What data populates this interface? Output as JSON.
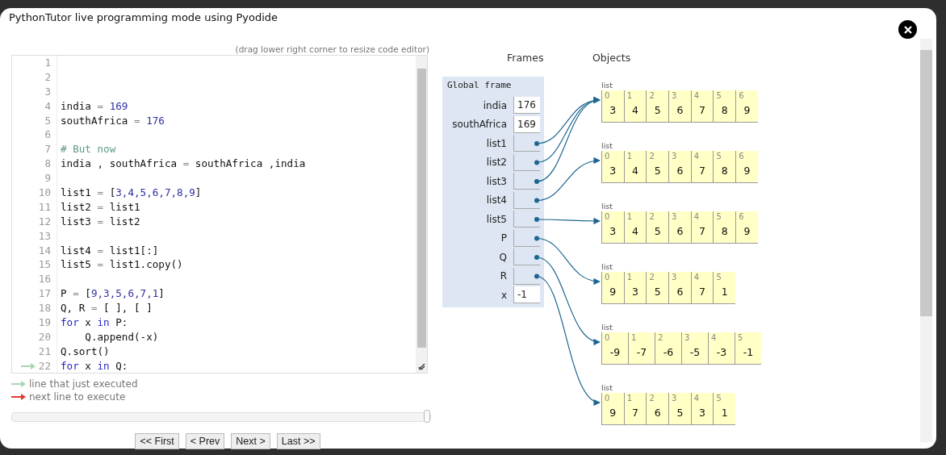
{
  "dialog": {
    "title": "PythonTutor live programming mode using Pyodide"
  },
  "editor": {
    "hint": "(drag lower right corner to resize code editor)",
    "lines": [
      {
        "number": "1",
        "executed": false
      },
      {
        "number": "2",
        "executed": false
      },
      {
        "number": "3",
        "executed": false
      },
      {
        "number": "4",
        "executed": false,
        "tokens": [
          {
            "text": "india ",
            "kind": "plain"
          },
          {
            "text": "= ",
            "kind": "op"
          },
          {
            "text": "169",
            "kind": "num"
          }
        ]
      },
      {
        "number": "5",
        "executed": false,
        "tokens": [
          {
            "text": "southAfrica ",
            "kind": "plain"
          },
          {
            "text": "= ",
            "kind": "op"
          },
          {
            "text": "176",
            "kind": "num"
          }
        ]
      },
      {
        "number": "6",
        "executed": false
      },
      {
        "number": "7",
        "executed": false,
        "tokens": [
          {
            "text": "# But now",
            "kind": "comment"
          }
        ]
      },
      {
        "number": "8",
        "executed": false,
        "tokens": [
          {
            "text": "india , southAfrica ",
            "kind": "plain"
          },
          {
            "text": "= ",
            "kind": "op"
          },
          {
            "text": "southAfrica ,india",
            "kind": "plain"
          }
        ]
      },
      {
        "number": "9",
        "executed": false
      },
      {
        "number": "10",
        "executed": false,
        "tokens": [
          {
            "text": "list1 ",
            "kind": "plain"
          },
          {
            "text": "= ",
            "kind": "op"
          },
          {
            "text": "[",
            "kind": "plain"
          },
          {
            "text": "3,4,5,6,7,8,9",
            "kind": "num"
          },
          {
            "text": "]",
            "kind": "plain"
          }
        ]
      },
      {
        "number": "11",
        "executed": false,
        "tokens": [
          {
            "text": "list2 ",
            "kind": "plain"
          },
          {
            "text": "= ",
            "kind": "op"
          },
          {
            "text": "list1",
            "kind": "plain"
          }
        ]
      },
      {
        "number": "12",
        "executed": false,
        "tokens": [
          {
            "text": "list3 ",
            "kind": "plain"
          },
          {
            "text": "= ",
            "kind": "op"
          },
          {
            "text": "list2",
            "kind": "plain"
          }
        ]
      },
      {
        "number": "13",
        "executed": false
      },
      {
        "number": "14",
        "executed": false,
        "tokens": [
          {
            "text": "list4 ",
            "kind": "plain"
          },
          {
            "text": "= ",
            "kind": "op"
          },
          {
            "text": "list1[:]",
            "kind": "plain"
          }
        ]
      },
      {
        "number": "15",
        "executed": false,
        "tokens": [
          {
            "text": "list5 ",
            "kind": "plain"
          },
          {
            "text": "= ",
            "kind": "op"
          },
          {
            "text": "list1.copy()",
            "kind": "plain"
          }
        ]
      },
      {
        "number": "16",
        "executed": false
      },
      {
        "number": "17",
        "executed": false,
        "tokens": [
          {
            "text": "P ",
            "kind": "plain"
          },
          {
            "text": "= ",
            "kind": "op"
          },
          {
            "text": "[",
            "kind": "plain"
          },
          {
            "text": "9,3,5,6,7,1",
            "kind": "num"
          },
          {
            "text": "]",
            "kind": "plain"
          }
        ]
      },
      {
        "number": "18",
        "executed": false,
        "tokens": [
          {
            "text": "Q, R ",
            "kind": "plain"
          },
          {
            "text": "= ",
            "kind": "op"
          },
          {
            "text": "[ ], [ ]",
            "kind": "plain"
          }
        ]
      },
      {
        "number": "19",
        "executed": false,
        "tokens": [
          {
            "text": "for",
            "kind": "kw"
          },
          {
            "text": " x ",
            "kind": "plain"
          },
          {
            "text": "in",
            "kind": "kw"
          },
          {
            "text": " P:",
            "kind": "plain"
          }
        ]
      },
      {
        "number": "20",
        "executed": false,
        "tokens": [
          {
            "text": "    Q.append(-x)",
            "kind": "plain"
          }
        ]
      },
      {
        "number": "21",
        "executed": false,
        "tokens": [
          {
            "text": "Q.sort()",
            "kind": "plain"
          }
        ]
      },
      {
        "number": "22",
        "executed": true,
        "tokens": [
          {
            "text": "for",
            "kind": "kw"
          },
          {
            "text": " x ",
            "kind": "plain"
          },
          {
            "text": "in",
            "kind": "kw"
          },
          {
            "text": " Q:",
            "kind": "plain"
          }
        ]
      }
    ]
  },
  "legend": [
    {
      "kind": "executed",
      "label": "line that just executed"
    },
    {
      "kind": "next",
      "label": "next line to execute"
    }
  ],
  "slider": {
    "level": 1
  },
  "buttons": [
    "<< First",
    "< Prev",
    "Next >",
    "Last >>"
  ],
  "visualizer": {
    "frames_heading": "Frames",
    "objects_heading": "Objects",
    "frame": {
      "title": "Global frame",
      "variables": [
        {
          "name": "india",
          "kind": "value",
          "value": "176"
        },
        {
          "name": "southAfrica",
          "kind": "value",
          "value": "169"
        },
        {
          "name": "list1",
          "kind": "pointer",
          "same_object_as_previous": false
        },
        {
          "name": "list2",
          "kind": "pointer",
          "same_object_as_previous": true
        },
        {
          "name": "list3",
          "kind": "pointer",
          "same_object_as_previous": true
        },
        {
          "name": "list4",
          "kind": "pointer",
          "same_object_as_previous": false
        },
        {
          "name": "list5",
          "kind": "pointer",
          "same_object_as_previous": false
        },
        {
          "name": "P",
          "kind": "pointer",
          "same_object_as_previous": false
        },
        {
          "name": "Q",
          "kind": "pointer",
          "same_object_as_previous": false
        },
        {
          "name": "R",
          "kind": "pointer",
          "same_object_as_previous": false
        },
        {
          "name": "x",
          "kind": "value",
          "value": "-1"
        }
      ]
    },
    "objects": [
      {
        "label": "list",
        "items": [
          {
            "index": "0",
            "value": "3"
          },
          {
            "index": "1",
            "value": "4"
          },
          {
            "index": "2",
            "value": "5"
          },
          {
            "index": "3",
            "value": "6"
          },
          {
            "index": "4",
            "value": "7"
          },
          {
            "index": "5",
            "value": "8"
          },
          {
            "index": "6",
            "value": "9"
          }
        ]
      },
      {
        "label": "list",
        "items": [
          {
            "index": "0",
            "value": "3"
          },
          {
            "index": "1",
            "value": "4"
          },
          {
            "index": "2",
            "value": "5"
          },
          {
            "index": "3",
            "value": "6"
          },
          {
            "index": "4",
            "value": "7"
          },
          {
            "index": "5",
            "value": "8"
          },
          {
            "index": "6",
            "value": "9"
          }
        ]
      },
      {
        "label": "list",
        "items": [
          {
            "index": "0",
            "value": "3"
          },
          {
            "index": "1",
            "value": "4"
          },
          {
            "index": "2",
            "value": "5"
          },
          {
            "index": "3",
            "value": "6"
          },
          {
            "index": "4",
            "value": "7"
          },
          {
            "index": "5",
            "value": "8"
          },
          {
            "index": "6",
            "value": "9"
          }
        ]
      },
      {
        "label": "list",
        "items": [
          {
            "index": "0",
            "value": "9"
          },
          {
            "index": "1",
            "value": "3"
          },
          {
            "index": "2",
            "value": "5"
          },
          {
            "index": "3",
            "value": "6"
          },
          {
            "index": "4",
            "value": "7"
          },
          {
            "index": "5",
            "value": "1"
          }
        ]
      },
      {
        "label": "list",
        "items": [
          {
            "index": "0",
            "value": "-9"
          },
          {
            "index": "1",
            "value": "-7"
          },
          {
            "index": "2",
            "value": "-6"
          },
          {
            "index": "3",
            "value": "-5"
          },
          {
            "index": "4",
            "value": "-3"
          },
          {
            "index": "5",
            "value": "-1"
          }
        ]
      },
      {
        "label": "list",
        "items": [
          {
            "index": "0",
            "value": "9"
          },
          {
            "index": "1",
            "value": "7"
          },
          {
            "index": "2",
            "value": "6"
          },
          {
            "index": "3",
            "value": "5"
          },
          {
            "index": "4",
            "value": "3"
          },
          {
            "index": "5",
            "value": "1"
          }
        ]
      }
    ]
  }
}
